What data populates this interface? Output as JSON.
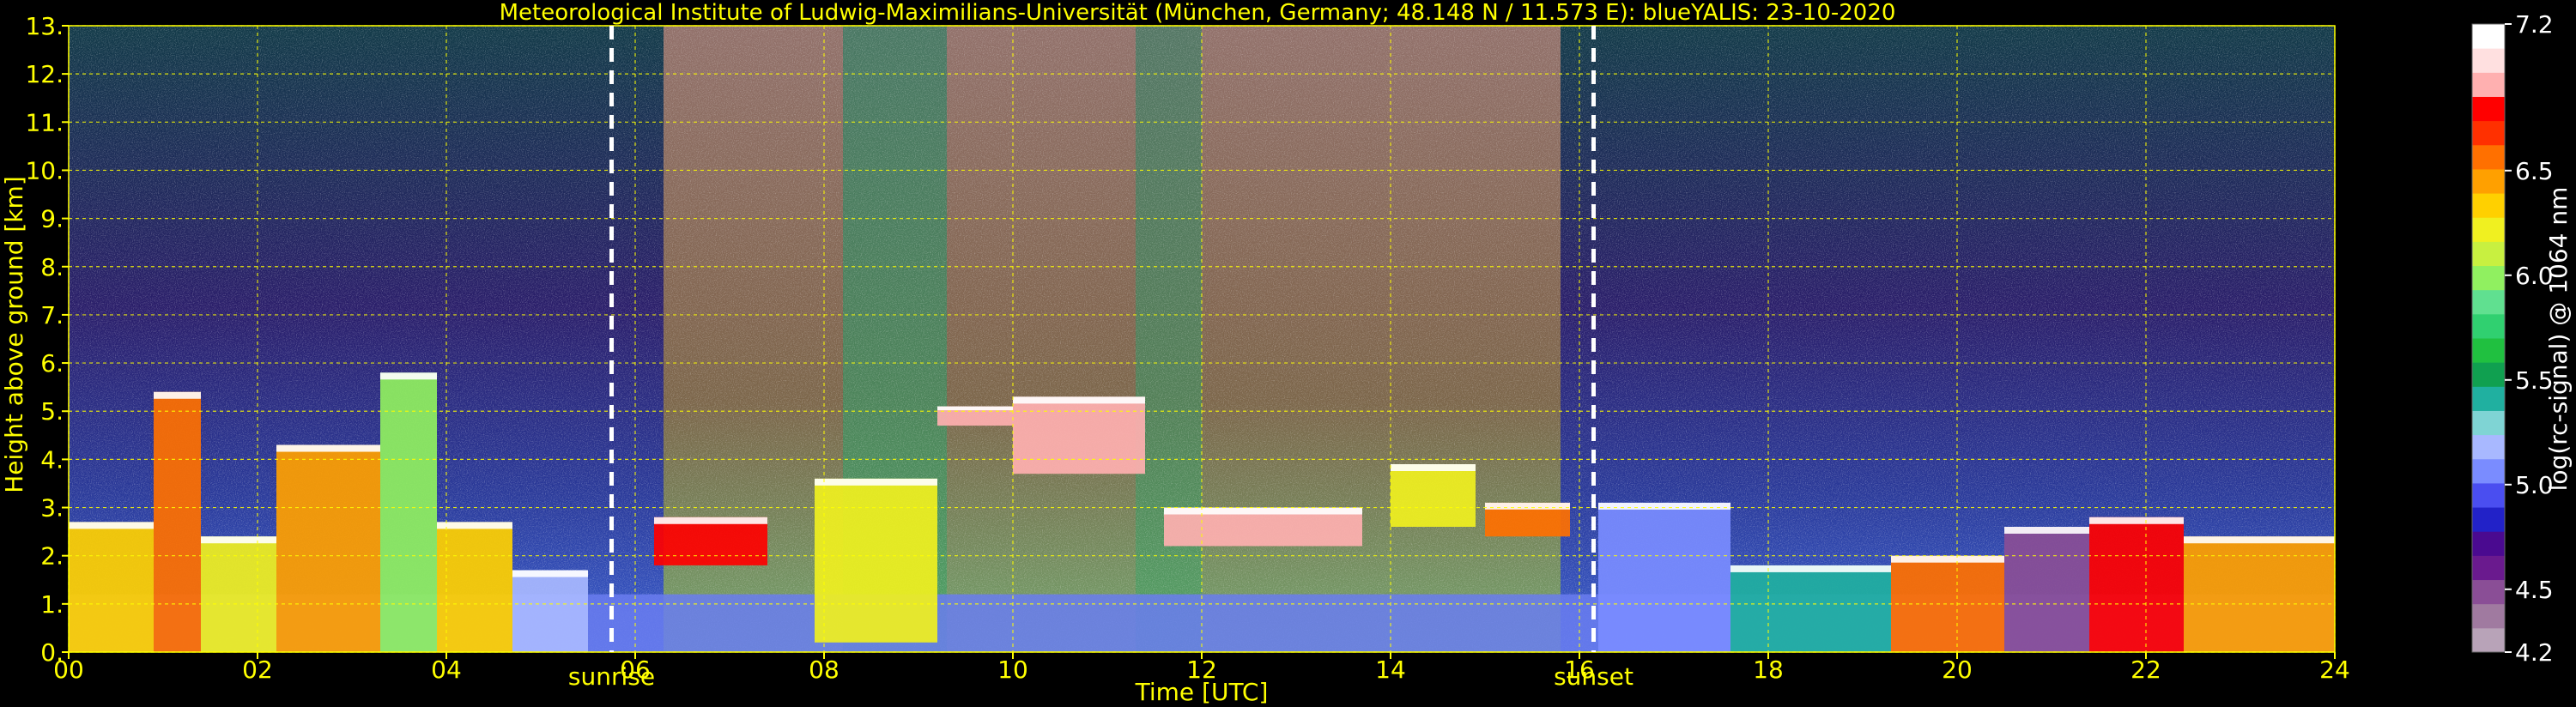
{
  "chart_data": {
    "type": "heatmap",
    "title": "Meteorological Institute of Ludwig-Maximilians-Universität (München, Germany; 48.148 N / 11.573 E):    blueYALIS: 23-10-2020",
    "xlabel": "Time [UTC]",
    "ylabel": "Height above ground [km]",
    "xlim": [
      0,
      24
    ],
    "ylim": [
      0,
      13
    ],
    "xticks": [
      0,
      2,
      4,
      6,
      8,
      10,
      12,
      14,
      16,
      18,
      20,
      22,
      24
    ],
    "xtick_labels": [
      "00",
      "02",
      "04",
      "06",
      "08",
      "10",
      "12",
      "14",
      "16",
      "18",
      "20",
      "22",
      "24"
    ],
    "yticks": [
      0,
      1,
      2,
      3,
      4,
      5,
      6,
      7,
      8,
      9,
      10,
      11,
      12,
      13
    ],
    "ytick_labels": [
      "0.",
      "1.",
      "2.",
      "3.",
      "4.",
      "5.",
      "6.",
      "7.",
      "8.",
      "9.",
      "10.",
      "11.",
      "12.",
      "13."
    ],
    "grid": true,
    "vertical_markers": [
      {
        "x": 5.75,
        "label": "sunrise"
      },
      {
        "x": 16.15,
        "label": "sunset"
      }
    ],
    "colorbar": {
      "label": "log(rc-signal) @ 1064 nm",
      "range": [
        4.2,
        7.2
      ],
      "ticks": [
        4.2,
        4.5,
        5.0,
        5.5,
        6.0,
        6.5,
        7.2
      ],
      "tick_labels": [
        "4.2",
        "4.5",
        "5.0",
        "5.5",
        "6.0",
        "6.5",
        "7.2"
      ],
      "colors": [
        "#b8a3b8",
        "#a07aa0",
        "#8a4e96",
        "#6a1a8e",
        "#4a0a90",
        "#2222c8",
        "#4a4ef0",
        "#7a8cff",
        "#a8b8ff",
        "#7fd4d4",
        "#20b0a0",
        "#10a050",
        "#20c040",
        "#30d070",
        "#60e090",
        "#90f060",
        "#c8f040",
        "#f0f020",
        "#ffd000",
        "#ffa000",
        "#ff7000",
        "#ff3000",
        "#ff0000",
        "#ffb0b0",
        "#ffe0e0",
        "#ffffff"
      ]
    },
    "cloud_layers": [
      {
        "x_start": 0.0,
        "x_end": 0.9,
        "base_km": 0.0,
        "top_km": 2.7,
        "value": 6.4
      },
      {
        "x_start": 0.9,
        "x_end": 1.4,
        "base_km": 0.0,
        "top_km": 5.4,
        "value": 6.6
      },
      {
        "x_start": 1.4,
        "x_end": 2.2,
        "base_km": 0.0,
        "top_km": 2.4,
        "value": 6.3
      },
      {
        "x_start": 2.2,
        "x_end": 3.3,
        "base_km": 0.0,
        "top_km": 4.3,
        "value": 6.5
      },
      {
        "x_start": 3.3,
        "x_end": 3.9,
        "base_km": 0.0,
        "top_km": 5.8,
        "value": 6.0
      },
      {
        "x_start": 3.9,
        "x_end": 4.7,
        "base_km": 0.0,
        "top_km": 2.7,
        "value": 6.4
      },
      {
        "x_start": 4.7,
        "x_end": 5.5,
        "base_km": 0.0,
        "top_km": 1.7,
        "value": 5.2
      },
      {
        "x_start": 6.2,
        "x_end": 7.4,
        "base_km": 1.8,
        "top_km": 2.8,
        "value": 6.8
      },
      {
        "x_start": 7.9,
        "x_end": 9.2,
        "base_km": 0.2,
        "top_km": 3.6,
        "value": 6.2
      },
      {
        "x_start": 9.2,
        "x_end": 10.0,
        "base_km": 4.7,
        "top_km": 5.1,
        "value": 6.9
      },
      {
        "x_start": 10.0,
        "x_end": 11.4,
        "base_km": 3.7,
        "top_km": 5.3,
        "value": 7.0
      },
      {
        "x_start": 11.6,
        "x_end": 13.7,
        "base_km": 2.2,
        "top_km": 3.0,
        "value": 6.9
      },
      {
        "x_start": 14.0,
        "x_end": 14.9,
        "base_km": 2.6,
        "top_km": 3.9,
        "value": 6.3
      },
      {
        "x_start": 15.0,
        "x_end": 15.9,
        "base_km": 2.4,
        "top_km": 3.1,
        "value": 6.6
      },
      {
        "x_start": 16.2,
        "x_end": 17.6,
        "base_km": 0.0,
        "top_km": 3.1,
        "value": 5.0
      },
      {
        "x_start": 17.6,
        "x_end": 19.3,
        "base_km": 0.0,
        "top_km": 1.8,
        "value": 5.4
      },
      {
        "x_start": 19.3,
        "x_end": 20.5,
        "base_km": 0.0,
        "top_km": 2.0,
        "value": 6.6
      },
      {
        "x_start": 20.5,
        "x_end": 21.4,
        "base_km": 0.0,
        "top_km": 2.6,
        "value": 4.5
      },
      {
        "x_start": 21.4,
        "x_end": 22.4,
        "base_km": 0.0,
        "top_km": 2.8,
        "value": 6.8
      },
      {
        "x_start": 22.4,
        "x_end": 24.0,
        "base_km": 0.0,
        "top_km": 2.4,
        "value": 6.5
      }
    ],
    "boundary_layer_km": 1.2
  }
}
